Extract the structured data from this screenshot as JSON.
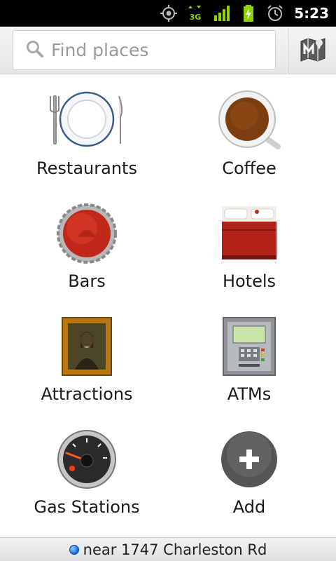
{
  "status_bar": {
    "time": "5:23",
    "network_label": "3G",
    "icons": [
      "gps-icon",
      "data-3g-icon",
      "signal-icon",
      "battery-charging-icon",
      "alarm-icon"
    ]
  },
  "search": {
    "placeholder": "Find places",
    "map_button_icon": "map-icon"
  },
  "categories": [
    {
      "label": "Restaurants",
      "icon": "restaurant-plate-icon"
    },
    {
      "label": "Coffee",
      "icon": "coffee-cup-icon"
    },
    {
      "label": "Bars",
      "icon": "bottle-cap-icon"
    },
    {
      "label": "Hotels",
      "icon": "hotel-bed-icon"
    },
    {
      "label": "Attractions",
      "icon": "painting-frame-icon"
    },
    {
      "label": "ATMs",
      "icon": "atm-machine-icon"
    },
    {
      "label": "Gas Stations",
      "icon": "fuel-gauge-icon"
    },
    {
      "label": "Add",
      "icon": "add-circle-icon"
    }
  ],
  "footer": {
    "location": "near 1747 Charleston Rd"
  },
  "colors": {
    "status_bar_bg": "#000000",
    "signal_green": "#8fd400",
    "accent_red": "#c0281a",
    "location_blue": "#1768d8"
  }
}
